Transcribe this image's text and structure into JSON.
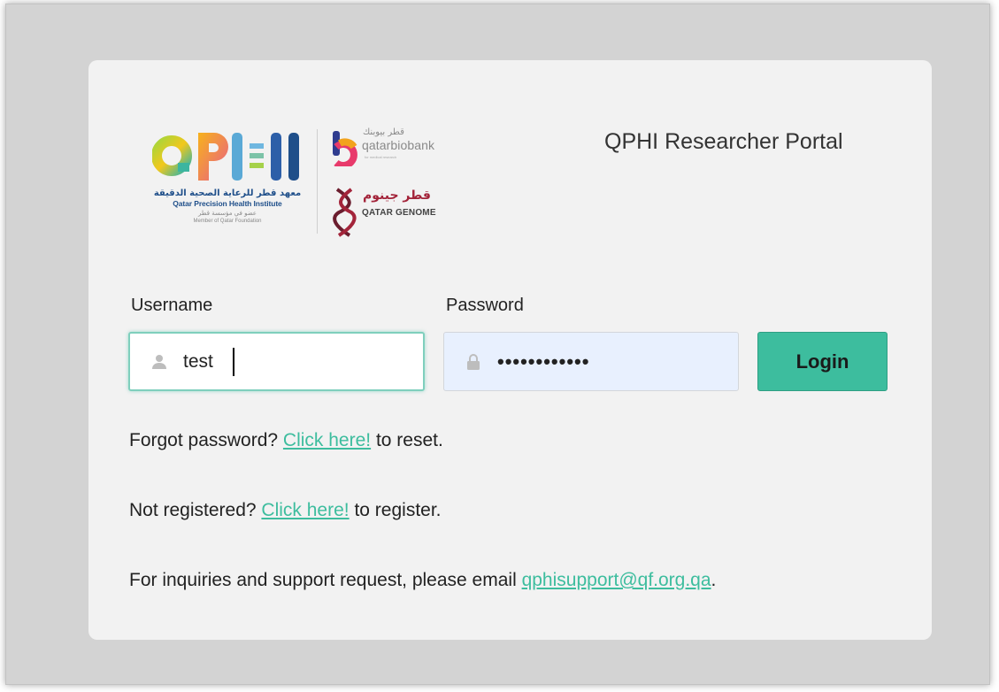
{
  "logos": {
    "qphi": {
      "wordmark": "QPHI",
      "arabic_name": "معهد قطر للرعاية الصحية الدقيقة",
      "english_name": "Qatar Precision Health Institute",
      "arabic_member": "عضو في مؤسسة قطر",
      "member_text": "Member of Qatar Foundation"
    },
    "qatar_biobank": {
      "arabic_name": "قطر بيوبنك",
      "english_name": "qatarbiobank",
      "tagline": "for medical research"
    },
    "qatar_genome": {
      "arabic_name": "قطر جينوم",
      "english_name": "QATAR GENOME"
    }
  },
  "portal_title": "QPHI Researcher Portal",
  "form": {
    "username_label": "Username",
    "username_value": "test",
    "password_label": "Password",
    "password_value": "testpassword",
    "login_label": "Login"
  },
  "links": {
    "forgot_prefix": "Forgot password? ",
    "forgot_link": "Click here!",
    "forgot_suffix": " to reset.",
    "register_prefix": "Not registered? ",
    "register_link": "Click here!",
    "register_suffix": " to register.",
    "support_prefix": "For inquiries and support request, please email ",
    "support_email": "qphisupport@qf.org.qa",
    "support_suffix": "."
  },
  "colors": {
    "accent": "#3dbd9e",
    "card_background": "#f2f2f2",
    "page_background": "#d3d3d3",
    "password_field_background": "#e8f0fe",
    "qphi_blue": "#1f4f8a",
    "genome_red": "#a3243a"
  },
  "icons": {
    "username": "user-icon",
    "password": "lock-icon"
  }
}
